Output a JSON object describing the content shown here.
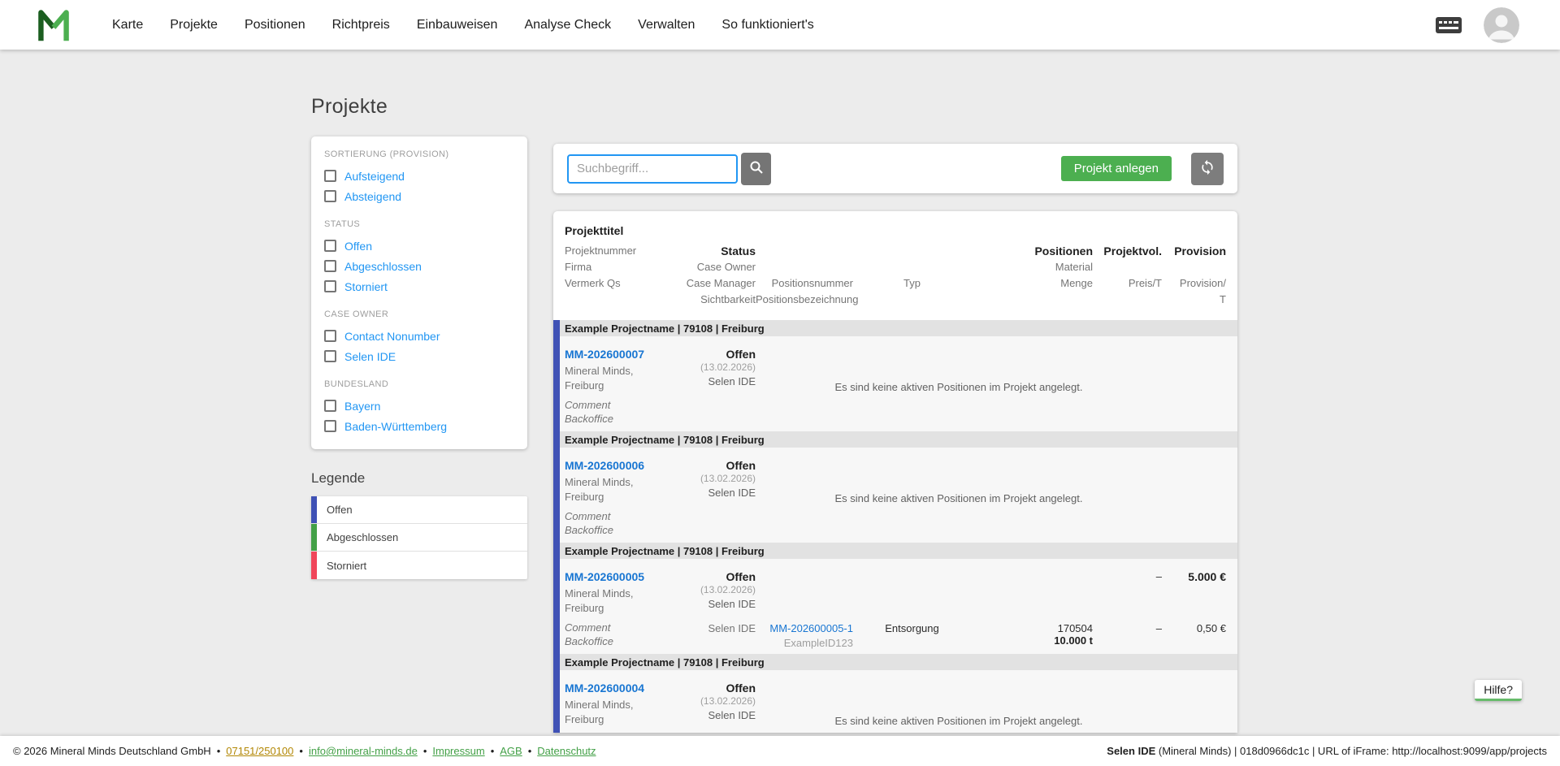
{
  "nav": {
    "items": [
      "Karte",
      "Projekte",
      "Positionen",
      "Richtpreis",
      "Einbauweisen",
      "Analyse Check",
      "Verwalten",
      "So funktioniert's"
    ]
  },
  "page": {
    "title": "Projekte"
  },
  "icons": {
    "logo": "mineral-minds-m-logo",
    "shortcuts": "keyboard-icon",
    "account": "avatar-icon",
    "search": "magnifier-icon",
    "refresh": "sync-icon"
  },
  "filters": {
    "sections": [
      {
        "label": "SORTIERUNG (PROVISION)",
        "options": [
          "Aufsteigend",
          "Absteigend"
        ]
      },
      {
        "label": "STATUS",
        "options": [
          "Offen",
          "Abgeschlossen",
          "Storniert"
        ]
      },
      {
        "label": "CASE OWNER",
        "options": [
          "Contact Nonumber",
          "Selen IDE"
        ]
      },
      {
        "label": "BUNDESLAND",
        "options": [
          "Bayern",
          "Baden-Württemberg"
        ]
      }
    ]
  },
  "legend": {
    "title": "Legende",
    "items": [
      {
        "label": "Offen",
        "color": "#3f51b5"
      },
      {
        "label": "Abgeschlossen",
        "color": "#43a047"
      },
      {
        "label": "Storniert",
        "color": "#f0455a"
      }
    ]
  },
  "toolbar": {
    "search_placeholder": "Suchbegriff...",
    "create_button": "Projekt anlegen"
  },
  "table": {
    "header": {
      "projekttitel": "Projekttitel",
      "projektnummer": "Projektnummer",
      "firma": "Firma",
      "vermerk_qs": "Vermerk Qs",
      "status": "Status",
      "case_owner": "Case Owner",
      "case_manager": "Case Manager",
      "sichtbarkeit": "Sichtbarkeit",
      "positionsnummer": "Positionsnummer",
      "positionsbezeichnung": "Positionsbezeichnung",
      "typ": "Typ",
      "positionen": "Positionen",
      "material": "Material",
      "menge": "Menge",
      "projektvol": "Projektvol.",
      "preis_t": "Preis/T",
      "provision": "Provision",
      "provision_t1": "Provision/",
      "provision_t2": "T"
    },
    "no_positions_note": "Es sind keine aktiven Positionen im Projekt angelegt.",
    "groups": [
      {
        "title": "Example Projectname | 79108 | Freiburg",
        "number": "MM-202600007",
        "status": "Offen",
        "status_date": "(13.02.2026)",
        "owner": "Selen IDE",
        "company": "Mineral Minds, Freiburg",
        "comment": "Comment",
        "backoffice": "Backoffice",
        "note": "Es sind keine aktiven Positionen im Projekt angelegt."
      },
      {
        "title": "Example Projectname | 79108 | Freiburg",
        "number": "MM-202600006",
        "status": "Offen",
        "status_date": "(13.02.2026)",
        "owner": "Selen IDE",
        "company": "Mineral Minds, Freiburg",
        "comment": "Comment",
        "backoffice": "Backoffice",
        "note": "Es sind keine aktiven Positionen im Projekt angelegt."
      },
      {
        "title": "Example Projectname | 79108 | Freiburg",
        "number": "MM-202600005",
        "status": "Offen",
        "status_date": "(13.02.2026)",
        "owner": "Selen IDE",
        "company": "Mineral Minds, Freiburg",
        "comment": "Comment",
        "backoffice": "Backoffice",
        "summary": {
          "preis_t": "–",
          "provision": "5.000 €"
        },
        "position": {
          "manager": "Selen IDE",
          "number": "MM-202600005-1",
          "bezeichnung": "ExampleID123",
          "typ": "Entsorgung",
          "material": "170504",
          "menge": "10.000 t",
          "preis_t": "–",
          "provision_t": "0,50 €"
        }
      },
      {
        "title": "Example Projectname | 79108 | Freiburg",
        "number": "MM-202600004",
        "status": "Offen",
        "status_date": "(13.02.2026)",
        "owner": "Selen IDE",
        "company": "Mineral Minds, Freiburg",
        "note": "Es sind keine aktiven Positionen im Projekt angelegt."
      }
    ]
  },
  "help_button": "Hilfe?",
  "footer": {
    "copyright": "© 2026 Mineral Minds Deutschland GmbH",
    "separator": "•",
    "phone": "07151/250100",
    "email": "info@mineral-minds.de",
    "impressum": "Impressum",
    "agb": "AGB",
    "datenschutz": "Datenschutz",
    "right_bold": "Selen IDE",
    "right_rest": " (Mineral Minds) | 018d0966dc1c | URL of iFrame: http://localhost:9099/app/projects"
  },
  "colors": {
    "accent_green": "#4caf50",
    "filter_link_blue": "#2196f3",
    "project_link_blue": "#1976d2",
    "status_open": "#3f51b5",
    "status_done": "#43a047",
    "status_cancelled": "#f0455a"
  }
}
